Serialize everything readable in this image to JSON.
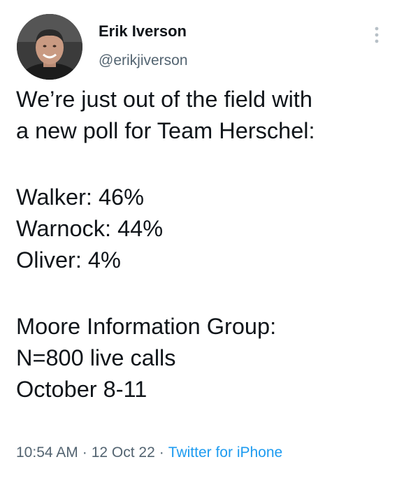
{
  "author": {
    "display_name": "Erik Iverson",
    "handle": "@erikjiverson"
  },
  "tweet": {
    "lines_1": [
      "We’re just out of the field with",
      "a new poll for Team Herschel:"
    ],
    "lines_2": [
      "Walker: 46%",
      "Warnock: 44%",
      "Oliver: 4%"
    ],
    "lines_3": [
      "Moore Information Group:",
      "N=800 live calls",
      "October 8-11"
    ]
  },
  "meta": {
    "time": "10:54 AM",
    "separator": "·",
    "date": "12 Oct 22",
    "source": "Twitter for iPhone"
  },
  "icons": {
    "more": "more-vertical-icon"
  },
  "colors": {
    "text": "#0f1419",
    "secondary": "#536471",
    "link": "#1d9bf0"
  }
}
